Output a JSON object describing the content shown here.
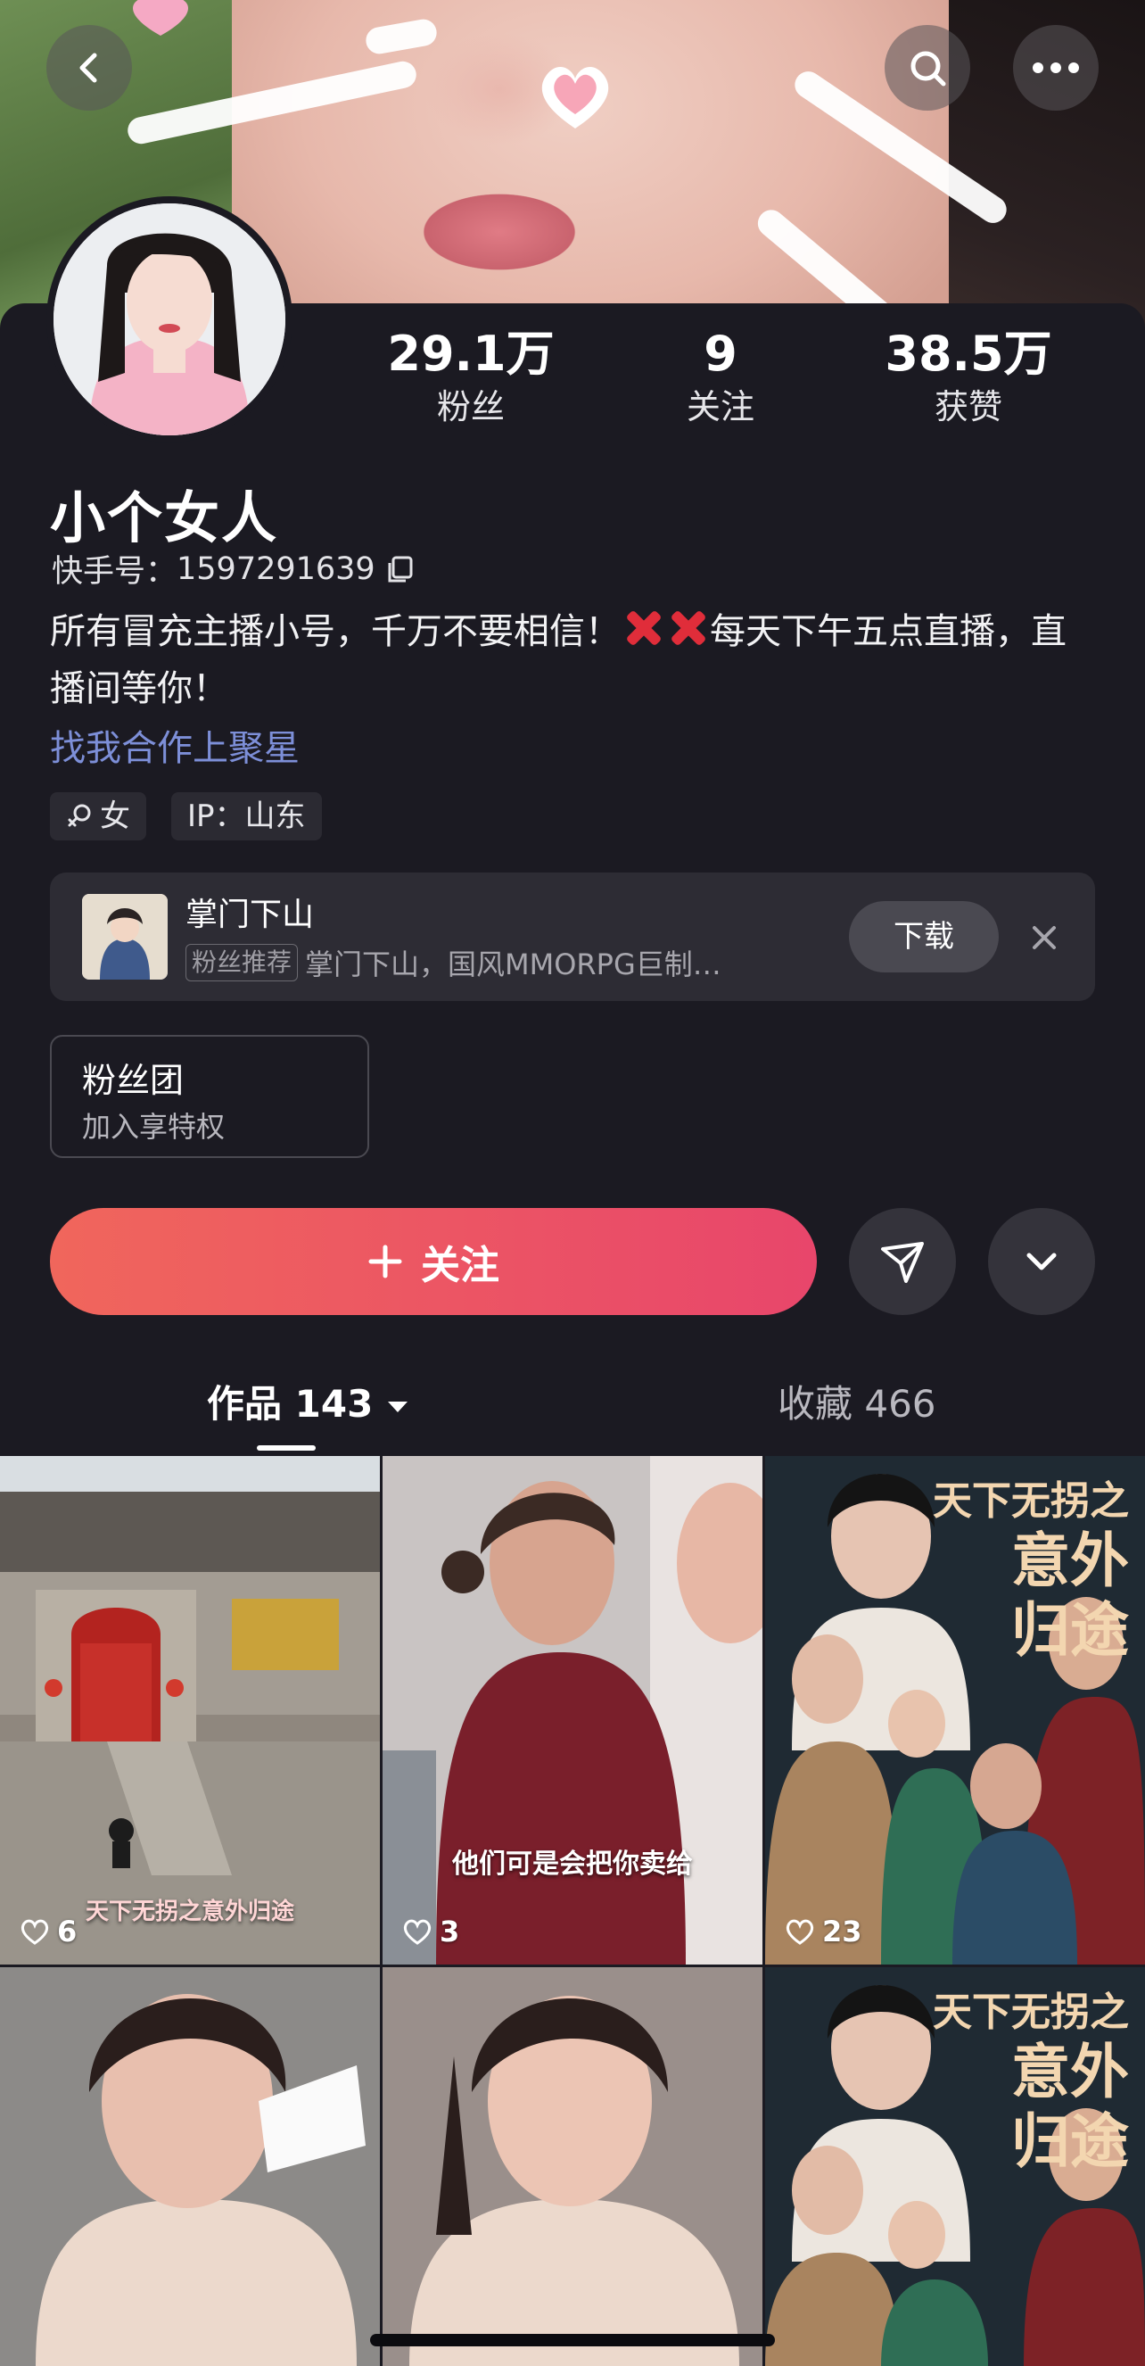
{
  "profile": {
    "name": "小个女人",
    "kuaishou_id_label": "快手号：",
    "kuaishou_id": "1597291639",
    "bio_part1": "所有冒充主播小号，千万不要相信！",
    "bio_part2": "每天下午五点直播，直播间等你！",
    "link_text": "找我合作上聚星",
    "gender_tag": "女",
    "ip_tag": "IP：山东"
  },
  "stats": [
    {
      "value": "29.1万",
      "label": "粉丝"
    },
    {
      "value": "9",
      "label": "关注"
    },
    {
      "value": "38.5万",
      "label": "获赞"
    }
  ],
  "ad": {
    "title": "掌门下山",
    "badge": "粉丝推荐",
    "desc": "掌门下山，国风MMORPG巨制…",
    "button": "下载"
  },
  "fan_club": {
    "title": "粉丝团",
    "subtitle": "加入享特权"
  },
  "actions": {
    "follow_label": "关注"
  },
  "tabs": {
    "works_label": "作品 143",
    "favorites_label": "收藏 466"
  },
  "videos": [
    {
      "likes": "6",
      "caption": "天下无拐之意外归途"
    },
    {
      "likes": "3",
      "caption": "他们可是会把你卖给"
    },
    {
      "likes": "23",
      "poster_line1": "天下无拐之",
      "poster_line2": "意外",
      "poster_line3": "归途"
    },
    {
      "likes": ""
    },
    {
      "likes": ""
    },
    {
      "likes": "",
      "poster_line1": "天下无拐之",
      "poster_line2": "意外",
      "poster_line3": "归途"
    }
  ],
  "icons": [
    "back-icon",
    "search-icon",
    "more-icon",
    "copy-icon",
    "female-icon",
    "close-icon",
    "plus-icon",
    "send-icon",
    "chevron-down-icon",
    "heart-icon",
    "caret-down-icon"
  ],
  "colors": {
    "background": "#1b1a22",
    "follow_start": "#f0665c",
    "follow_end": "#e8466b",
    "link": "#7d8fd8"
  }
}
